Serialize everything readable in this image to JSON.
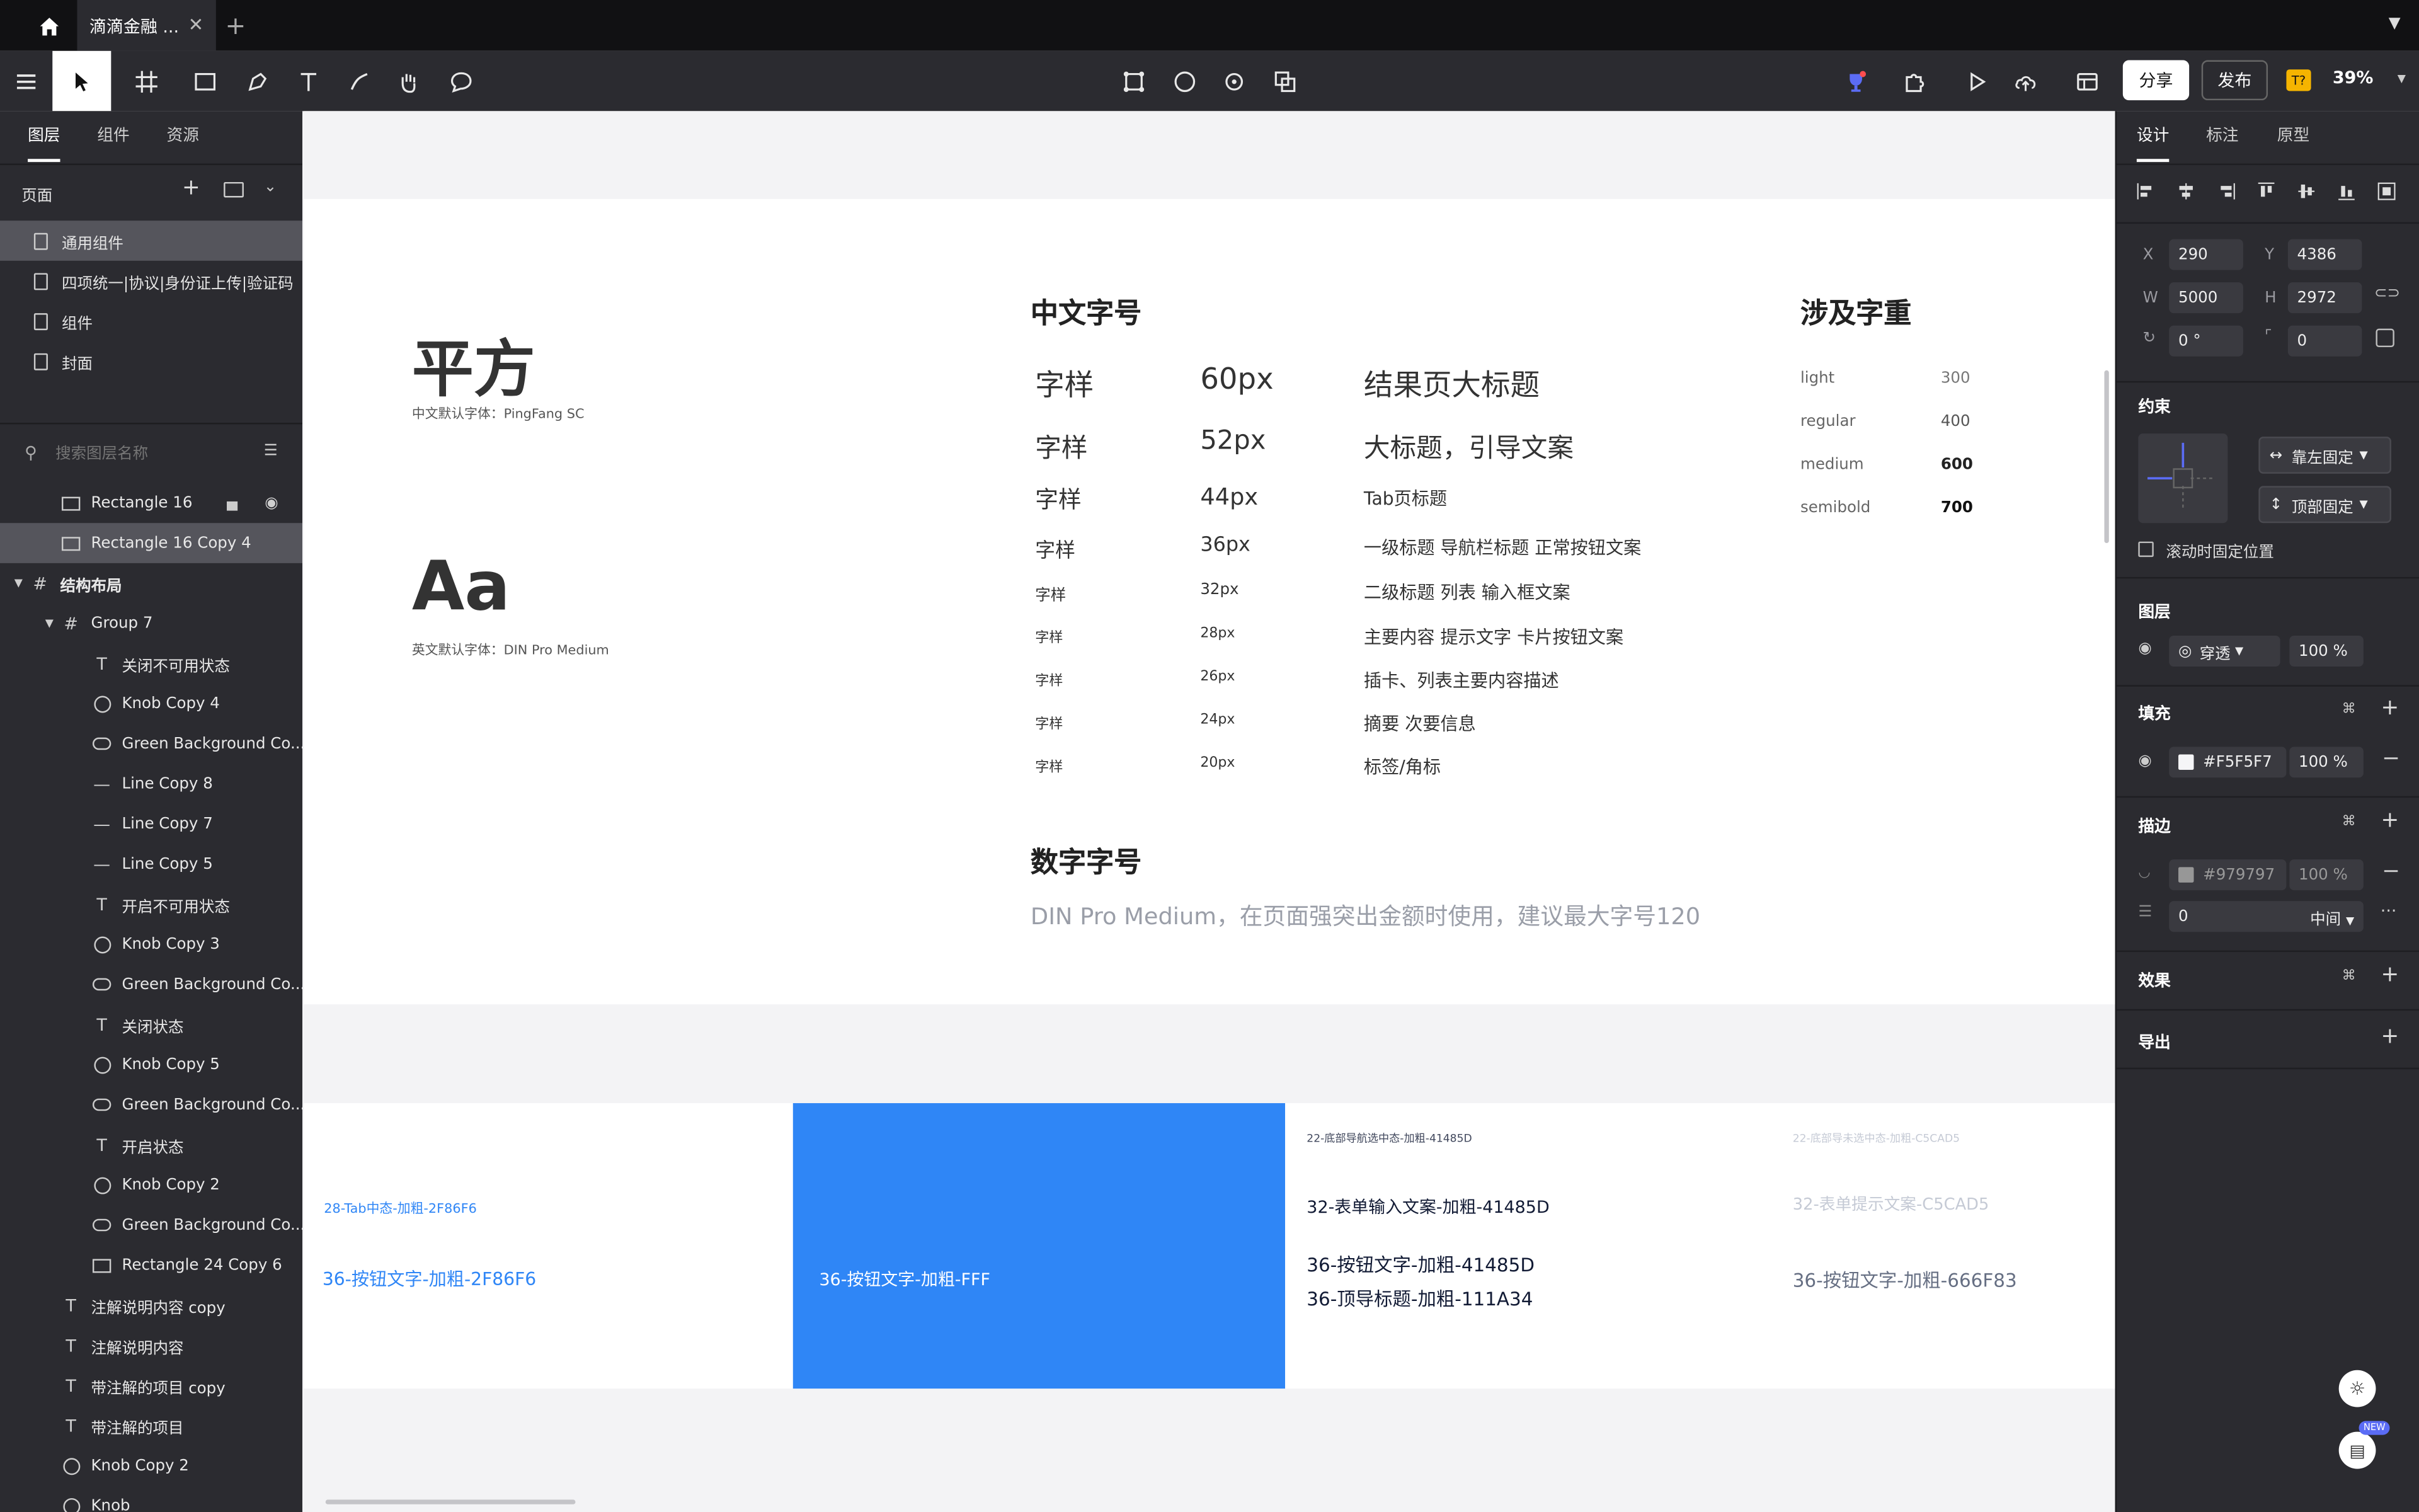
{
  "window": {
    "doc_tab": "滴滴金融 ...",
    "zoom": "39%",
    "share": "分享",
    "publish": "发布",
    "badge": "T?"
  },
  "left_panel": {
    "tabs": [
      "图层",
      "组件",
      "资源"
    ],
    "pages_title": "页面",
    "pages": [
      "通用组件",
      "四项统一|协议|身份证上传|验证码",
      "组件",
      "封面"
    ],
    "search_placeholder": "搜索图层名称",
    "layers": [
      {
        "name": "Rectangle 16",
        "type": "rect",
        "indent": 1
      },
      {
        "name": "Rectangle 16 Copy 4",
        "type": "rect",
        "indent": 1
      },
      {
        "name": "结构布局",
        "type": "frame",
        "indent": 0
      },
      {
        "name": "Group 7",
        "type": "frame",
        "indent": 1
      },
      {
        "name": "关闭不可用状态",
        "type": "text",
        "indent": 2
      },
      {
        "name": "Knob Copy 4",
        "type": "ellipse",
        "indent": 2
      },
      {
        "name": "Green Background Co...",
        "type": "pill",
        "indent": 2
      },
      {
        "name": "Line Copy 8",
        "type": "line",
        "indent": 2
      },
      {
        "name": "Line Copy 7",
        "type": "line",
        "indent": 2
      },
      {
        "name": "Line Copy 5",
        "type": "line",
        "indent": 2
      },
      {
        "name": "开启不可用状态",
        "type": "text",
        "indent": 2
      },
      {
        "name": "Knob Copy 3",
        "type": "ellipse",
        "indent": 2
      },
      {
        "name": "Green Background Co...",
        "type": "pill",
        "indent": 2
      },
      {
        "name": "关闭状态",
        "type": "text",
        "indent": 2
      },
      {
        "name": "Knob Copy 5",
        "type": "ellipse",
        "indent": 2
      },
      {
        "name": "Green Background Co...",
        "type": "pill",
        "indent": 2
      },
      {
        "name": "开启状态",
        "type": "text",
        "indent": 2
      },
      {
        "name": "Knob Copy 2",
        "type": "ellipse",
        "indent": 2
      },
      {
        "name": "Green Background Co...",
        "type": "pill",
        "indent": 2
      },
      {
        "name": "Rectangle 24 Copy 6",
        "type": "rect",
        "indent": 2
      },
      {
        "name": "注解说明内容 copy",
        "type": "text",
        "indent": 1
      },
      {
        "name": "注解说明内容",
        "type": "text",
        "indent": 1
      },
      {
        "name": "带注解的项目 copy",
        "type": "text",
        "indent": 1
      },
      {
        "name": "带注解的项目",
        "type": "text",
        "indent": 1
      },
      {
        "name": "Knob Copy 2",
        "type": "ellipse",
        "indent": 1
      },
      {
        "name": "Knob",
        "type": "ellipse",
        "indent": 1
      }
    ]
  },
  "artboard": {
    "pf_title": "平方",
    "pf_sub": "中文默认字体：PingFang SC",
    "aa_title": "Aa",
    "aa_sub": "英文默认字体：DIN Pro  Medium",
    "cn_heading": "中文字号",
    "cn_rows": [
      {
        "sample": "字样",
        "size": "60px",
        "usage": "结果页大标题"
      },
      {
        "sample": "字样",
        "size": "52px",
        "usage": "大标题，引导文案"
      },
      {
        "sample": "字样",
        "size": "44px",
        "usage": "Tab页标题"
      },
      {
        "sample": "字样",
        "size": "36px",
        "usage": "一级标题  导航栏标题  正常按钮文案"
      },
      {
        "sample": "字样",
        "size": "32px",
        "usage": "二级标题  列表  输入框文案"
      },
      {
        "sample": "字样",
        "size": "28px",
        "usage": "主要内容  提示文字  卡片按钮文案"
      },
      {
        "sample": "字样",
        "size": "26px",
        "usage": "插卡、列表主要内容描述"
      },
      {
        "sample": "字样",
        "size": "24px",
        "usage": "摘要  次要信息"
      },
      {
        "sample": "字样",
        "size": "20px",
        "usage": "标签/角标"
      }
    ],
    "weight_heading": "涉及字重",
    "weights": [
      {
        "name": "light",
        "value": "300"
      },
      {
        "name": "regular",
        "value": "400"
      },
      {
        "name": "medium",
        "value": "600"
      },
      {
        "name": "semibold",
        "value": "700"
      }
    ],
    "num_heading": "数字字号",
    "num_desc": "DIN Pro  Medium，在页面强突出金额时使用，建议最大字号120"
  },
  "artboard2": {
    "col1_small": "28-Tab中态-加粗-2F86F6",
    "col1_big": "36-按钮文字-加粗-2F86F6",
    "col2_big": "36-按钮文字-加粗-FFF",
    "col3_small": "22-底部导航选中态-加粗-41485D",
    "col3_mid": "32-表单输入文案-加粗-41485D",
    "col3_big1": "36-按钮文字-加粗-41485D",
    "col3_big2": "36-顶导标题-加粗-111A34",
    "col4_small": "22-底部导未选中态-加粗-C5CAD5",
    "col4_mid": "32-表单提示文案-C5CAD5",
    "col4_big": "36-按钮文字-加粗-666F83",
    "blue": "#2F86F6"
  },
  "right_panel": {
    "tabs": [
      "设计",
      "标注",
      "原型"
    ],
    "x_label": "X",
    "x": "290",
    "y_label": "Y",
    "y": "4386",
    "w_label": "W",
    "w": "5000",
    "h_label": "H",
    "h": "2972",
    "rotation": "0 °",
    "radius": "0",
    "constraints_title": "约束",
    "constraint_h": "靠左固定",
    "constraint_v": "顶部固定",
    "fix_on_scroll": "滚动时固定位置",
    "layer_title": "图层",
    "blend": "穿透",
    "opacity": "100 %",
    "fill_title": "填充",
    "fill_hex": "#F5F5F7",
    "fill_opacity": "100 %",
    "stroke_title": "描边",
    "stroke_hex": "#979797",
    "stroke_opacity": "100 %",
    "stroke_width": "0",
    "stroke_pos": "中间",
    "effects_title": "效果",
    "export_title": "导出",
    "new_badge": "NEW"
  }
}
